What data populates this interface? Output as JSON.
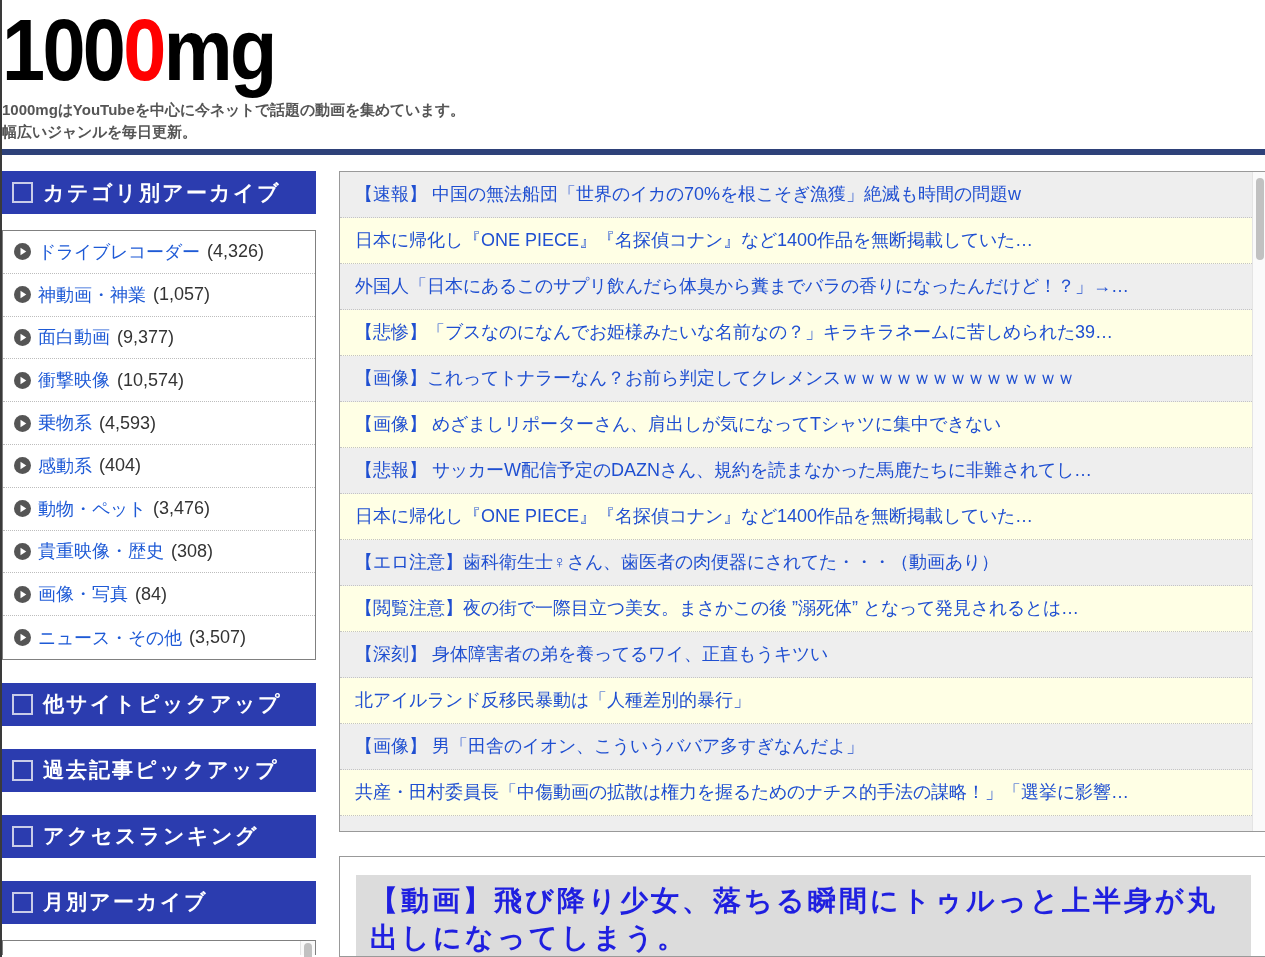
{
  "header": {
    "logo": {
      "parts": [
        {
          "text": "100",
          "color": "#000000"
        },
        {
          "text": "0",
          "color": "#ff0000"
        },
        {
          "text": "mg",
          "color": "#000000"
        }
      ]
    },
    "tagline": [
      "1000mgはYouTubeを中心に今ネットで話題の動画を集めています。",
      "幅広いジャンルを毎日更新。"
    ]
  },
  "sidebar": {
    "widgets": [
      {
        "title": "カテゴリ別アーカイブ",
        "kind": "list",
        "items": [
          {
            "label": "ドライブレコーダー",
            "count": "(4,326)"
          },
          {
            "label": "神動画・神業",
            "count": "(1,057)"
          },
          {
            "label": "面白動画",
            "count": "(9,377)"
          },
          {
            "label": "衝撃映像",
            "count": "(10,574)"
          },
          {
            "label": "乗物系",
            "count": "(4,593)"
          },
          {
            "label": "感動系",
            "count": "(404)"
          },
          {
            "label": "動物・ペット",
            "count": "(3,476)"
          },
          {
            "label": "貴重映像・歴史",
            "count": "(308)"
          },
          {
            "label": "画像・写真",
            "count": "(84)"
          },
          {
            "label": "ニュース・その他",
            "count": "(3,507)"
          }
        ]
      },
      {
        "title": "他サイトピックアップ",
        "kind": "heading"
      },
      {
        "title": "過去記事ピックアップ",
        "kind": "heading"
      },
      {
        "title": "アクセスランキング",
        "kind": "heading"
      },
      {
        "title": "月別アーカイブ",
        "kind": "scroll_box"
      }
    ]
  },
  "main": {
    "headlines": [
      "【速報】 中国の無法船団「世界のイカの70%を根こそぎ漁獲」絶滅も時間の問題w",
      "日本に帰化し『ONE PIECE』『名探偵コナン』など1400作品を無断掲載していた…",
      "外国人「日本にあるこのサプリ飲んだら体臭から糞までバラの香りになったんだけど！？」→…",
      "【悲惨】「ブスなのになんでお姫様みたいな名前なの？」キラキラネームに苦しめられた39…",
      "【画像】これってトナラーなん？お前ら判定してクレメンスｗｗｗｗｗｗｗｗｗｗｗｗｗ",
      "【画像】 めざましリポーターさん、肩出しが気になってTシャツに集中できない",
      "【悲報】 サッカーW配信予定のDAZNさん、規約を読まなかった馬鹿たちに非難されてし…",
      "日本に帰化し『ONE PIECE』『名探偵コナン』など1400作品を無断掲載していた…",
      "【エロ注意】歯科衛生士♀さん、歯医者の肉便器にされてた・・・（動画あり）",
      "【閲覧注意】夜の街で一際目立つ美女。まさかこの後 ”溺死体” となって発見されるとは…",
      "【深刻】 身体障害者の弟を養ってるワイ、正直もうキツい",
      "北アイルランド反移民暴動は「人種差別的暴行」",
      "【画像】 男「田舎のイオン、こういうババア多すぎなんだよ」",
      "共産・田村委員長「中傷動画の拡散は権力を握るためのナチス的手法の謀略！」「選挙に影響…"
    ],
    "featured_article": {
      "title": "【動画】飛び降り少女、落ちる瞬間にトゥルっと上半身が丸出しになってしまう。"
    }
  }
}
